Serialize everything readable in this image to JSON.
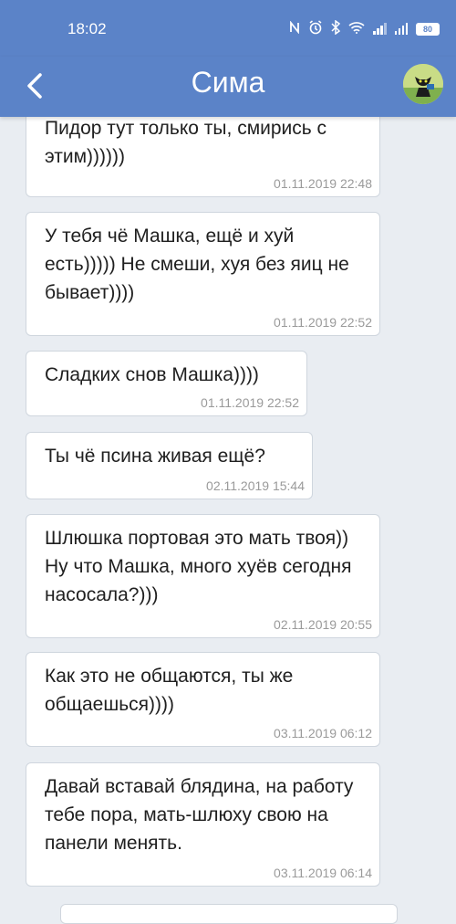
{
  "status_bar": {
    "time": "18:02",
    "battery": "80",
    "icons": [
      "nfc-icon",
      "alarm-icon",
      "bluetooth-icon",
      "wifi-icon",
      "signal-icon",
      "signal-icon",
      "battery-icon"
    ]
  },
  "header": {
    "title": "Сима",
    "back_icon": "chevron-left-icon",
    "avatar": "cat-avatar"
  },
  "colors": {
    "header_bg": "#5b83c8",
    "chat_bg": "#e9edf2",
    "bubble_bg": "#ffffff"
  },
  "messages": [
    {
      "text": "Пидор тут только ты, смирись с этим))))))",
      "time": "01.11.2019 22:48"
    },
    {
      "text": "У тебя чё Машка, ещё и хуй есть))))) Не смеши, хуя без яиц не бывает))))",
      "time": "01.11.2019 22:52"
    },
    {
      "text": "Сладких снов Машка))))",
      "time": "01.11.2019 22:52"
    },
    {
      "text": "Ты чё псина живая ещё?",
      "time": "02.11.2019 15:44"
    },
    {
      "text": "Шлюшка портовая это мать твоя)) Ну что Машка, много хуёв сегодня насосала?)))",
      "time": "02.11.2019 20:55"
    },
    {
      "text": "Как это не общаются, ты же общаешься))))",
      "time": "03.11.2019 06:12"
    },
    {
      "text": "Давай вставай блядина, на работу тебе пора, мать-шлюху свою на панели менять.",
      "time": "03.11.2019 06:14"
    }
  ]
}
